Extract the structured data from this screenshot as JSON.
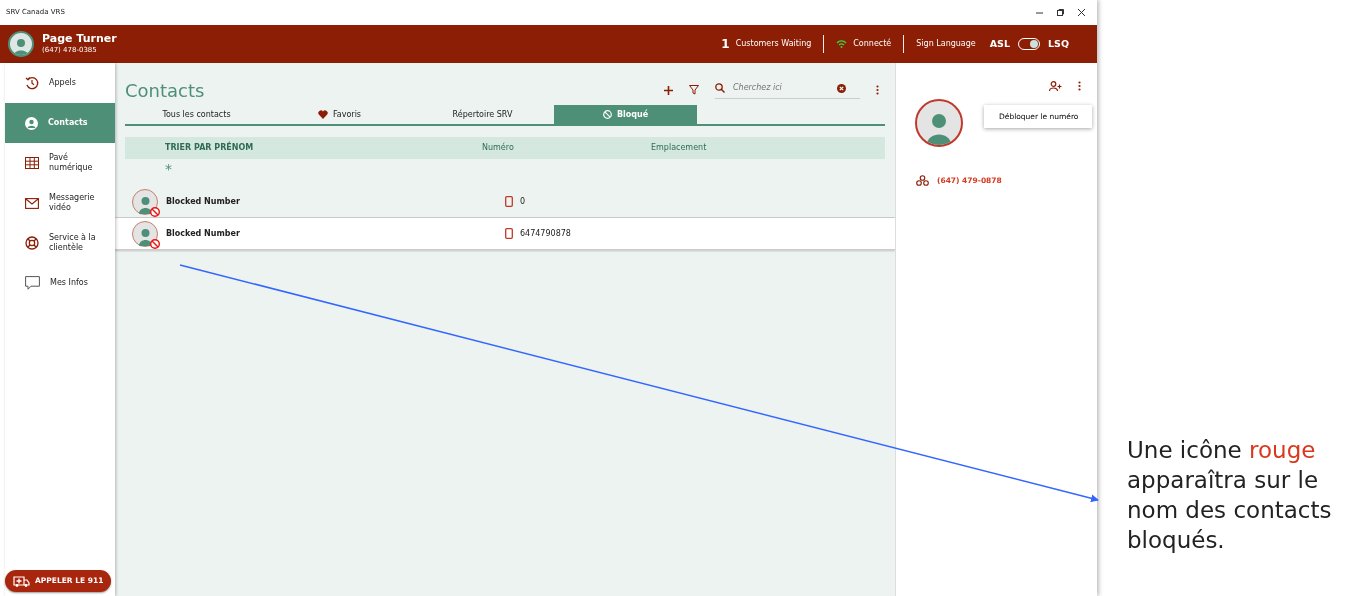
{
  "window": {
    "title": "SRV Canada VRS"
  },
  "header": {
    "user_name": "Page Turner",
    "user_phone": "(647) 478-0385",
    "waiting_count": "1",
    "waiting_label": "Customers Waiting",
    "connection": "Connecté",
    "sign_language_label": "Sign Language",
    "toggle": {
      "left": "ASL",
      "right": "LSQ",
      "on": true
    }
  },
  "sidebar": {
    "items": [
      {
        "label": "Appels",
        "kind": "history",
        "selected": false
      },
      {
        "label": "Contacts",
        "kind": "person",
        "selected": true
      },
      {
        "label": "Pavé numérique",
        "kind": "grid",
        "selected": false
      },
      {
        "label": "Messagerie vidéo",
        "kind": "mail",
        "selected": false
      },
      {
        "label": "Service à la clientèle",
        "kind": "lifebuoy",
        "selected": false
      },
      {
        "label": "Mes Infos",
        "kind": "chat",
        "selected": false
      }
    ],
    "emergency_button": "APPELER LE 911"
  },
  "contacts": {
    "title": "Contacts",
    "search": {
      "placeholder": "Cherchez ici"
    },
    "tabs": [
      {
        "label": "Tous les contacts",
        "kind": "plain",
        "selected": false
      },
      {
        "label": "Favoris",
        "kind": "heart",
        "selected": false
      },
      {
        "label": "Répertoire SRV",
        "kind": "plain",
        "selected": false
      },
      {
        "label": "Bloqué",
        "kind": "blocked",
        "selected": true
      }
    ],
    "columns": [
      "TRIER PAR PRÉNOM",
      "Numéro",
      "Emplacement"
    ],
    "group_letter": "*",
    "rows": [
      {
        "name": "Blocked Number",
        "number": "0",
        "blocked": true,
        "selected": false
      },
      {
        "name": "Blocked Number",
        "number": "6474790878",
        "blocked": true,
        "selected": true
      }
    ]
  },
  "detail": {
    "phone": "(647) 479-0878",
    "menu_item": "Débloquer le numéro"
  },
  "annotation": {
    "parts": [
      {
        "text": "Une icône ",
        "highlight": false
      },
      {
        "text": "rouge",
        "highlight": true
      },
      {
        "text": " apparaîtra sur le nom des contacts bloqués.",
        "highlight": false
      }
    ]
  }
}
